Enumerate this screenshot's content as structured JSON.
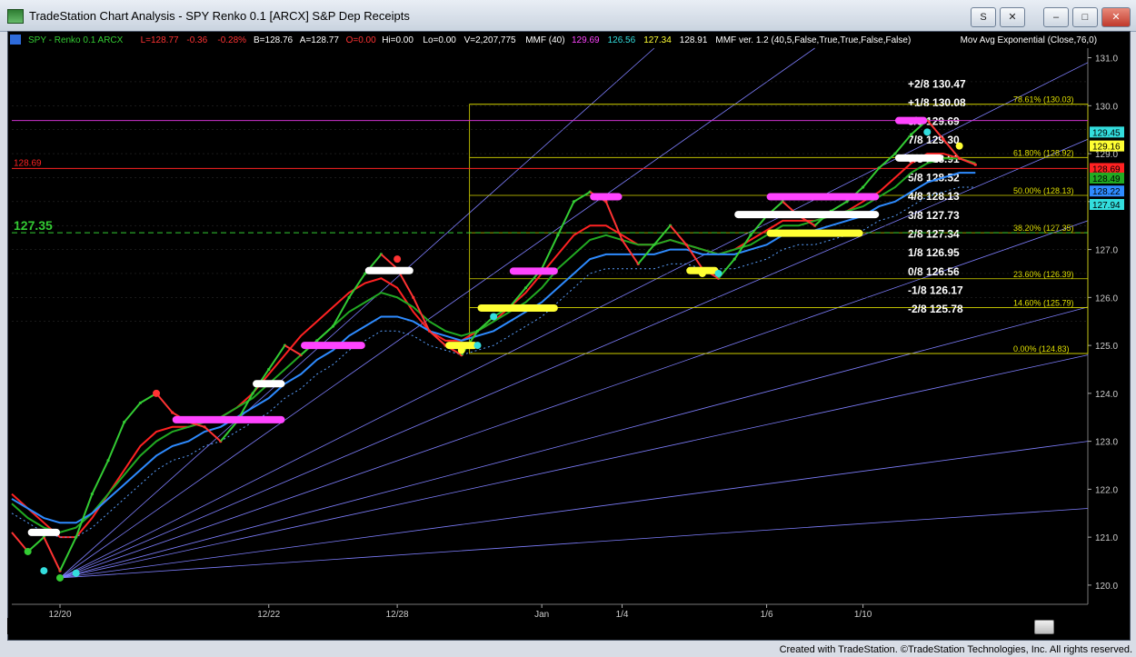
{
  "window": {
    "title": "TradeStation Chart Analysis - SPY Renko 0.1 [ARCX] S&P Dep Receipts",
    "controls": {
      "s_label": "S",
      "close_small": "✕",
      "minimize": "–",
      "maximize": "□",
      "close": "✕"
    }
  },
  "status_bar": [
    {
      "text": "SPY - Renko 0.1  ARCX",
      "color": "#33cc33"
    },
    {
      "text": "L=128.77",
      "color": "#ff3333"
    },
    {
      "text": "-0.36",
      "color": "#ff3333"
    },
    {
      "text": "-0.28%",
      "color": "#ff3333"
    },
    {
      "text": "B=128.76",
      "color": "#ffffff"
    },
    {
      "text": "A=128.77",
      "color": "#ffffff"
    },
    {
      "text": "O=0.00",
      "color": "#ff3333"
    },
    {
      "text": "Hi=0.00",
      "color": "#ffffff"
    },
    {
      "text": "Lo=0.00",
      "color": "#ffffff"
    },
    {
      "text": "V=2,207,775",
      "color": "#ffffff"
    },
    {
      "text": "MMF (40)",
      "color": "#ffffff"
    },
    {
      "text": "129.69",
      "color": "#ff44ff"
    },
    {
      "text": "126.56",
      "color": "#33dddd"
    },
    {
      "text": "127.34",
      "color": "#ffff33"
    },
    {
      "text": "128.91",
      "color": "#ffffff"
    },
    {
      "text": "MMF ver. 1.2 (40,5,False,True,True,False,False)",
      "color": "#ffffff"
    },
    {
      "text": "Mov Avg Exponential (Close,76,0)",
      "color": "#ffffff"
    }
  ],
  "colors": {
    "background": "#000000",
    "bull": "#33cc33",
    "bear": "#ff3333",
    "magenta": "#ff44ff",
    "yellow": "#ffff33",
    "cyan": "#33dddd",
    "fan": "#7f7fff"
  },
  "footer": "Created with TradeStation. ©TradeStation Technologies, Inc. All rights reserved.",
  "chart_data": {
    "type": "line",
    "title": "",
    "ylim": [
      119.6,
      131.2
    ],
    "y_ticks": [
      "120.0",
      "121.0",
      "122.0",
      "123.0",
      "124.0",
      "125.0",
      "126.0",
      "127.0",
      "128.0",
      "129.0",
      "130.0",
      "131.0"
    ],
    "x_ticks": [
      {
        "label": "12/20",
        "index": 3
      },
      {
        "label": "12/22",
        "index": 16
      },
      {
        "label": "12/28",
        "index": 24
      },
      {
        "label": "Jan",
        "index": 33
      },
      {
        "label": "1/4",
        "index": 38
      },
      {
        "label": "1/6",
        "index": 47
      },
      {
        "label": "1/10",
        "index": 53
      }
    ],
    "xlim": [
      0,
      67
    ],
    "price_series": {
      "name": "SPY Renko 0.1",
      "values": [
        121.1,
        120.7,
        121.0,
        120.3,
        121.0,
        121.9,
        122.6,
        123.4,
        123.8,
        124.0,
        123.6,
        123.4,
        123.3,
        123.0,
        123.4,
        124.0,
        124.5,
        125.0,
        124.8,
        125.1,
        125.4,
        126.0,
        126.5,
        126.9,
        126.6,
        126.0,
        125.3,
        125.0,
        124.8,
        125.3,
        125.6,
        125.8,
        126.2,
        126.6,
        127.3,
        128.0,
        128.2,
        128.0,
        127.2,
        126.7,
        127.1,
        127.5,
        127.1,
        126.6,
        126.4,
        126.8,
        127.3,
        127.7,
        128.0,
        127.7,
        127.5,
        127.8,
        128.0,
        128.3,
        128.7,
        129.0,
        129.4,
        129.7,
        129.3,
        128.9,
        128.77
      ]
    },
    "moving_averages": [
      {
        "name": "",
        "color": "#ff2222",
        "values": [
          121.9,
          121.6,
          121.3,
          121.0,
          121.0,
          121.4,
          121.9,
          122.4,
          122.9,
          123.2,
          123.3,
          123.3,
          123.4,
          123.5,
          123.7,
          124.0,
          124.4,
          124.8,
          125.2,
          125.5,
          125.8,
          126.1,
          126.3,
          126.4,
          126.2,
          125.7,
          125.3,
          125.1,
          125.1,
          125.3,
          125.5,
          125.8,
          126.1,
          126.5,
          126.9,
          127.3,
          127.5,
          127.5,
          127.3,
          127.1,
          127.1,
          127.2,
          127.1,
          127.0,
          126.9,
          127.0,
          127.2,
          127.4,
          127.6,
          127.6,
          127.6,
          127.7,
          127.8,
          128.0,
          128.2,
          128.5,
          128.8,
          129.0,
          129.0,
          128.9,
          128.8
        ]
      },
      {
        "name": "",
        "color": "#22aa22",
        "values": [
          121.7,
          121.4,
          121.2,
          121.1,
          121.2,
          121.5,
          121.9,
          122.3,
          122.7,
          123.0,
          123.2,
          123.3,
          123.4,
          123.5,
          123.7,
          123.9,
          124.2,
          124.5,
          124.8,
          125.1,
          125.4,
          125.7,
          125.9,
          126.1,
          126.0,
          125.8,
          125.5,
          125.3,
          125.2,
          125.3,
          125.5,
          125.7,
          125.9,
          126.2,
          126.6,
          126.9,
          127.2,
          127.3,
          127.2,
          127.1,
          127.1,
          127.2,
          127.1,
          127.0,
          126.9,
          127.0,
          127.1,
          127.3,
          127.5,
          127.5,
          127.6,
          127.7,
          127.8,
          127.9,
          128.1,
          128.3,
          128.6,
          128.8,
          128.9,
          128.9,
          128.8
        ]
      },
      {
        "name": "",
        "color": "#2e8bff",
        "values": [
          121.8,
          121.6,
          121.4,
          121.3,
          121.3,
          121.5,
          121.8,
          122.1,
          122.4,
          122.7,
          122.9,
          123.0,
          123.2,
          123.3,
          123.5,
          123.7,
          123.9,
          124.2,
          124.4,
          124.7,
          124.9,
          125.2,
          125.4,
          125.6,
          125.6,
          125.5,
          125.3,
          125.2,
          125.1,
          125.2,
          125.3,
          125.5,
          125.7,
          125.9,
          126.2,
          126.5,
          126.8,
          126.9,
          126.9,
          126.9,
          126.9,
          127.0,
          127.0,
          126.9,
          126.9,
          126.9,
          127.0,
          127.1,
          127.3,
          127.4,
          127.4,
          127.5,
          127.6,
          127.7,
          127.9,
          128.0,
          128.2,
          128.4,
          128.5,
          128.6,
          128.6
        ]
      }
    ],
    "gann_levels": [
      {
        "label": "+2/8",
        "value": 130.47
      },
      {
        "label": "+1/8",
        "value": 130.08
      },
      {
        "label": "8/8",
        "value": 129.69
      },
      {
        "label": "7/8",
        "value": 129.3
      },
      {
        "label": "6/8",
        "value": 128.91
      },
      {
        "label": "5/8",
        "value": 128.52
      },
      {
        "label": "4/8",
        "value": 128.13
      },
      {
        "label": "3/8",
        "value": 127.73
      },
      {
        "label": "2/8",
        "value": 127.34
      },
      {
        "label": "1/8",
        "value": 126.95
      },
      {
        "label": "0/8",
        "value": 126.56
      },
      {
        "label": "-1/8",
        "value": 126.17
      },
      {
        "label": "-2/8",
        "value": 125.78
      }
    ],
    "fib_levels": [
      {
        "label": "78.61% (130.03)",
        "value": 130.03
      },
      {
        "label": "61.80% (128.92)",
        "value": 128.92
      },
      {
        "label": "50.00% (128.13)",
        "value": 128.13
      },
      {
        "label": "38.20% (127.35)",
        "value": 127.35
      },
      {
        "label": "23.60% (126.39)",
        "value": 126.39
      },
      {
        "label": "14.60% (125.79)",
        "value": 125.79
      },
      {
        "label": "0.00% (124.83)",
        "value": 124.83
      }
    ],
    "horizontal_lines": [
      {
        "label": "128.69",
        "value": 128.69,
        "color": "#ff2222"
      },
      {
        "label": "127.35",
        "value": 127.35,
        "color": "#33cc33"
      }
    ],
    "price_markers": [
      {
        "label": "129.45",
        "value": 129.45,
        "color": "#33dddd",
        "text_color": "#000000"
      },
      {
        "label": "129.16",
        "value": 129.16,
        "color": "#ffff33",
        "text_color": "#000000"
      },
      {
        "label": "128.69",
        "value": 128.69,
        "color": "#ff2222",
        "text_color": "#000000"
      },
      {
        "label": "128.49",
        "value": 128.49,
        "color": "#22aa22",
        "text_color": "#000000"
      },
      {
        "label": "128.22",
        "value": 128.22,
        "color": "#2e8bff",
        "text_color": "#000000"
      },
      {
        "label": "127.94",
        "value": 127.94,
        "color": "#33dddd",
        "text_color": "#000000"
      }
    ],
    "blocks": [
      {
        "color": "#ff44ff",
        "start": 10,
        "end": 17,
        "value": 123.45
      },
      {
        "color": "#ff44ff",
        "start": 18,
        "end": 22,
        "value": 125.0
      },
      {
        "color": "#ff44ff",
        "start": 31,
        "end": 34,
        "value": 126.55
      },
      {
        "color": "#ff44ff",
        "start": 36,
        "end": 38,
        "value": 128.1
      },
      {
        "color": "#ff44ff",
        "start": 47,
        "end": 54,
        "value": 128.1
      },
      {
        "color": "#ff44ff",
        "start": 55,
        "end": 57,
        "value": 129.69
      },
      {
        "color": "#ffff33",
        "start": 27,
        "end": 29,
        "value": 125.0
      },
      {
        "color": "#ffff33",
        "start": 29,
        "end": 34,
        "value": 125.78
      },
      {
        "color": "#ffff33",
        "start": 42,
        "end": 44,
        "value": 126.56
      },
      {
        "color": "#ffff33",
        "start": 47,
        "end": 53,
        "value": 127.34
      },
      {
        "color": "#ffffff",
        "start": 1,
        "end": 3,
        "value": 121.1
      },
      {
        "color": "#ffffff",
        "start": 15,
        "end": 17,
        "value": 124.2
      },
      {
        "color": "#ffffff",
        "start": 22,
        "end": 25,
        "value": 126.56
      },
      {
        "color": "#ffffff",
        "start": 45,
        "end": 54,
        "value": 127.73
      },
      {
        "color": "#ffffff",
        "start": 55,
        "end": 58,
        "value": 128.91
      }
    ]
  }
}
